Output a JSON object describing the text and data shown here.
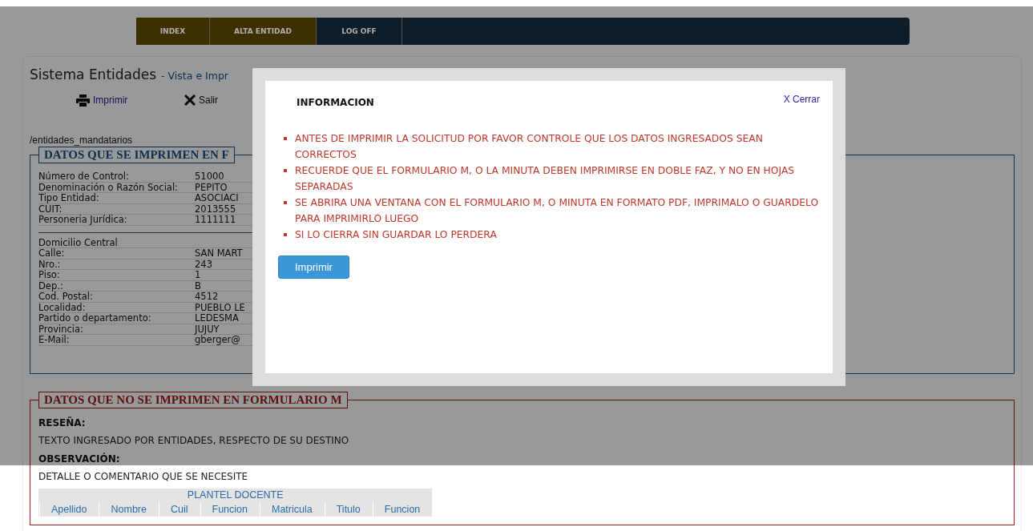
{
  "nav": {
    "tabs": [
      {
        "label": "INDEX",
        "color": "#3d3000"
      },
      {
        "label": "ALTA ENTIDAD",
        "color": "#3d3000"
      },
      {
        "label": "LOG OFF",
        "color": "#0f1d28"
      }
    ]
  },
  "page": {
    "title": "Sistema Entidades",
    "subtitle": "- Vista e Impr",
    "actions": [
      {
        "kind": "print",
        "label": "Imprimir"
      },
      {
        "kind": "close",
        "label": "Salir"
      }
    ],
    "path": "/entidades_mandatarios",
    "printed_section": {
      "legend": "DATOS QUE SE IMPRIMEN EN F",
      "rows": [
        {
          "label": "Número de Control:",
          "value": "51000"
        },
        {
          "label": "Denominación o Razón Social:",
          "value": "PEPITO"
        },
        {
          "label": "Tipo Entidad:",
          "value": "ASOCIACI"
        },
        {
          "label": "CUIT:",
          "value": "2013555"
        },
        {
          "label": "Personeria Jurídica:",
          "value": "1111111"
        }
      ],
      "address_heading": "Domicilio Central",
      "address_rows": [
        {
          "label": "Calle:",
          "value": "SAN MART"
        },
        {
          "label": "Nro.:",
          "value": "243"
        },
        {
          "label": "Piso:",
          "value": "1"
        },
        {
          "label": "Dep.:",
          "value": "B"
        },
        {
          "label": "Cod. Postal:",
          "value": "4512"
        },
        {
          "label": "Localidad:",
          "value": "PUEBLO LE"
        },
        {
          "label": "Partido o departamento:",
          "value": "LEDESMA"
        },
        {
          "label": "Provincia:",
          "value": "JUJUY"
        },
        {
          "label": "E-Mail:",
          "value": "gberger@"
        }
      ]
    },
    "unprinted_section": {
      "legend": "DATOS QUE NO SE IMPRIMEN EN FORMULARIO M",
      "fields": [
        {
          "label": "RESEÑA:",
          "value": "TEXTO INGRESADO POR ENTIDADES, RESPECTO DE SU DESTINO"
        },
        {
          "label": "OBSERVACIÓN:",
          "value": "DETALLE O COMENTARIO QUE SE NECESITE"
        }
      ],
      "table": {
        "title": "PLANTEL DOCENTE",
        "columns": [
          "Apellido",
          "Nombre",
          "Cuil",
          "Funcion",
          "Matricula",
          "Titulo",
          "Funcion"
        ]
      }
    }
  },
  "modal": {
    "title": "INFORMACION",
    "close": "X Cerrar",
    "items": [
      "ANTES DE IMPRIMIR LA SOLICITUD POR FAVOR CONTROLE QUE LOS DATOS INGRESADOS SEAN CORRECTOS",
      "RECUERDE QUE EL FORMULARIO M, O LA MINUTA DEBEN IMPRIMIRSE EN DOBLE FAZ, Y NO EN HOJAS SEPARADAS",
      "SE ABRIRA UNA VENTANA CON EL FORMULARIO M, O MINUTA EN FORMATO PDF, IMPRIMALO O GUARDELO PARA IMPRIMIRLO LUEGO",
      "SI LO CIERRA SIN GUARDAR LO PERDERA"
    ],
    "button": "Imprimir"
  }
}
